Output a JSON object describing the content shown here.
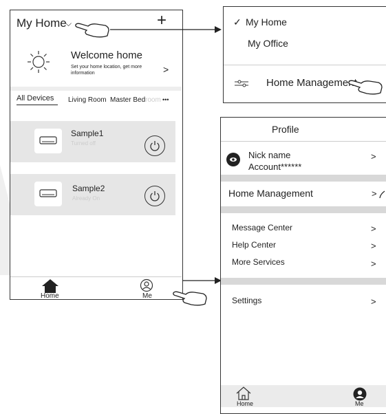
{
  "left_screen": {
    "home_selector": "My Home",
    "add_symbol": "+",
    "welcome": {
      "title": "Welcome home",
      "subtitle": "Set your home location, get more information",
      "arrow": ">"
    },
    "tabs": [
      {
        "label": "All Devices",
        "active": true
      },
      {
        "label": "Living Room",
        "active": false
      },
      {
        "label": "Master Bed",
        "active": false
      },
      {
        "label": "room",
        "active": false
      }
    ],
    "more_symbol": "•••",
    "devices": [
      {
        "name": "Sample1",
        "status": "Turned off"
      },
      {
        "name": "Sample2",
        "status": "Already On"
      }
    ],
    "bottom_nav": {
      "home": "Home",
      "me": "Me"
    }
  },
  "dropdown": {
    "check": "✓",
    "items": [
      "My Home",
      "My Office"
    ],
    "management": "Home Management"
  },
  "profile": {
    "title": "Profile",
    "nickname": "Nick name",
    "account": "Account******",
    "arrow": ">",
    "home_management": "Home Management",
    "menu": [
      "Message Center",
      "Help Center",
      "More Services"
    ],
    "settings": "Settings",
    "bottom_nav": {
      "home": "Home",
      "me": "Me"
    }
  },
  "colors": {
    "frame": "#333333",
    "band": "#e6e6e6",
    "watermark": "#efefef",
    "accent": "#222222"
  }
}
